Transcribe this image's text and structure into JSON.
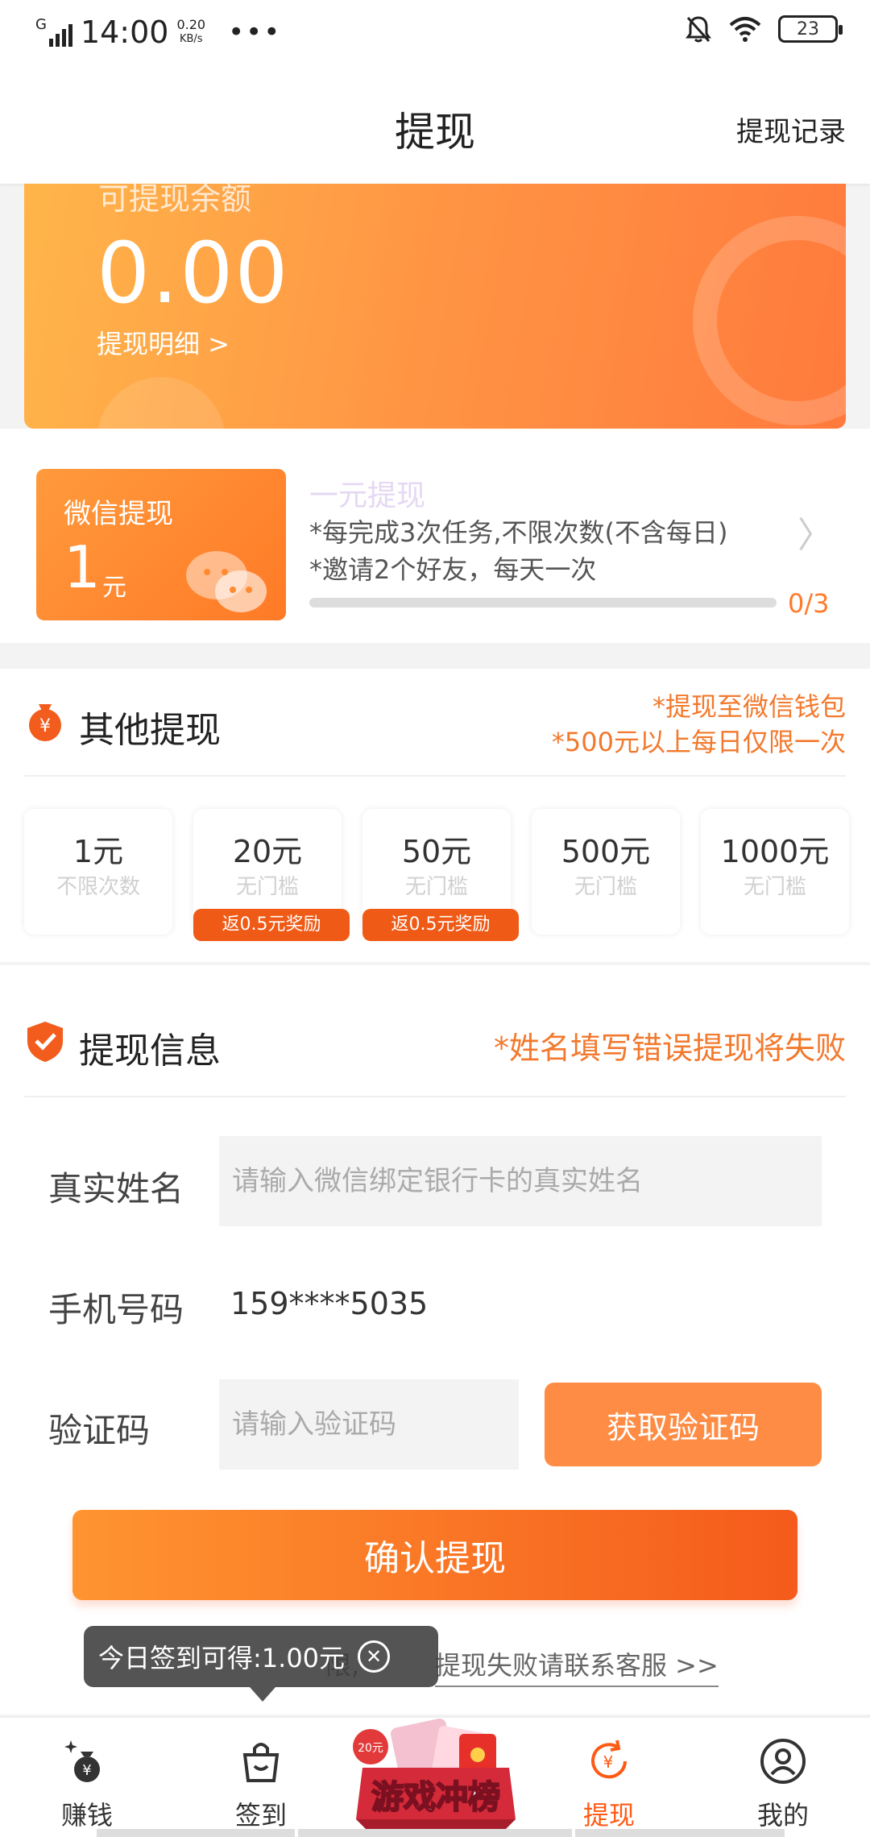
{
  "status_bar": {
    "signal": "G",
    "time": "14:00",
    "speed_value": "0.20",
    "speed_unit": "KB/s",
    "more": "•••",
    "battery": "23"
  },
  "header": {
    "title": "提现",
    "record_link": "提现记录"
  },
  "balance": {
    "label": "可提现余额",
    "amount": "0.00",
    "detail_link": "提现明细 >"
  },
  "wechat": {
    "card_title": "微信提现",
    "card_amount": "1",
    "card_unit": "元",
    "title": "一元提现",
    "rule1": "*每完成3次任务,不限次数(不含每日)",
    "rule2": "*邀请2个好友，每天一次",
    "progress": 0.0,
    "progress_text": "0/3",
    "arrow": "〉"
  },
  "other": {
    "title": "其他提现",
    "note1": "*提现至微信钱包",
    "note2": "*500元以上每日仅限一次",
    "options": [
      {
        "value": "1元",
        "sub": "不限次数",
        "badge": ""
      },
      {
        "value": "20元",
        "sub": "无门槛",
        "badge": "返0.5元奖励"
      },
      {
        "value": "50元",
        "sub": "无门槛",
        "badge": "返0.5元奖励"
      },
      {
        "value": "500元",
        "sub": "无门槛",
        "badge": ""
      },
      {
        "value": "1000元",
        "sub": "无门槛",
        "badge": ""
      }
    ]
  },
  "info": {
    "title": "提现信息",
    "warning": "*姓名填写错误提现将失败",
    "name_label": "真实姓名",
    "name_placeholder": "请输入微信绑定银行卡的真实姓名",
    "phone_label": "手机号码",
    "phone_value": "159****5035",
    "code_label": "验证码",
    "code_placeholder": "请输入验证码",
    "get_code_button": "获取验证码",
    "confirm_button": "确认提现",
    "help_visible": "提现失败请联系客服 >>",
    "help_prefix": "限,"
  },
  "toast": {
    "text": "今日签到可得:1.00元",
    "close": "✕"
  },
  "tabs": [
    {
      "label": "赚钱"
    },
    {
      "label": "签到"
    },
    {
      "label": "提现"
    },
    {
      "label": "我的"
    }
  ],
  "game_banner": {
    "text": "游戏冲榜",
    "tag": "20元"
  },
  "colors": {
    "accent": "#ff7b2a",
    "active_tab": "#ff5a14",
    "badge": "#ef5a16"
  }
}
